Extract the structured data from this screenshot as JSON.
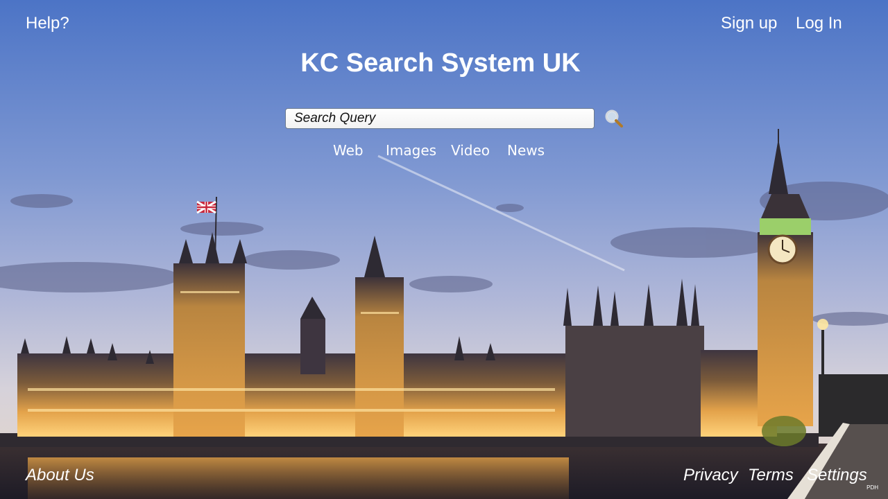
{
  "header": {
    "help_label": "Help?",
    "signup_label": "Sign up",
    "login_label": "Log In"
  },
  "main": {
    "title": "KC Search System UK",
    "search": {
      "value": "",
      "placeholder": "Search Query",
      "button_icon": "magnifier-icon"
    },
    "categories": [
      "Web",
      "Images",
      "Video",
      "News"
    ]
  },
  "background": {
    "subject": "houses-of-parliament-dusk-photo",
    "flag_icon": "union-jack-flag-icon"
  },
  "footer": {
    "about_label": "About Us",
    "privacy_label": "Privacy",
    "terms_label": "Terms",
    "settings_label": "Settings"
  },
  "corner_mark": "PDH",
  "colors": {
    "text": "#ffffff",
    "sky_top": "#4f78c8",
    "sky_bottom": "#c9cde0",
    "building_light": "#f2b24a",
    "water": "#2d2a33"
  }
}
